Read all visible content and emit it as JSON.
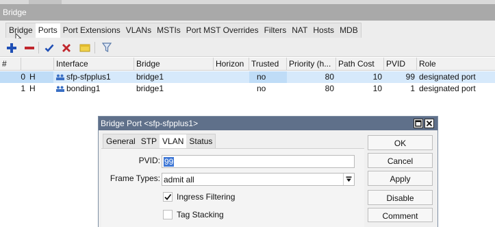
{
  "window": {
    "title": "Bridge"
  },
  "tabs": [
    "Bridge",
    "Ports",
    "Port Extensions",
    "VLANs",
    "MSTIs",
    "Port MST Overrides",
    "Filters",
    "NAT",
    "Hosts",
    "MDB"
  ],
  "active_tab": "Ports",
  "toolbar": {
    "buttons": [
      "add-icon",
      "remove-icon",
      "enable-icon",
      "disable-icon",
      "comment-icon",
      "filter-icon"
    ],
    "colors": {
      "add": "#1f4fb5",
      "remove": "#c0262c",
      "enable": "#1f4fb5",
      "disable": "#c0262c",
      "comment": "#e9c531",
      "filter": "#5a7aa8"
    }
  },
  "table": {
    "headers": {
      "num": "#",
      "interface": "Interface",
      "bridge": "Bridge",
      "horizon": "Horizon",
      "trusted": "Trusted",
      "priority": "Priority (h...",
      "path_cost": "Path Cost",
      "pvid": "PVID",
      "role": "Role"
    },
    "rows": [
      {
        "num": "0",
        "flag": "H",
        "interface": "sfp-sfpplus1",
        "bridge": "bridge1",
        "horizon": "",
        "trusted": "no",
        "priority": "80",
        "path_cost": "10",
        "pvid": "99",
        "role": "designated port"
      },
      {
        "num": "1",
        "flag": "H",
        "interface": "bonding1",
        "bridge": "bridge1",
        "horizon": "",
        "trusted": "no",
        "priority": "80",
        "path_cost": "10",
        "pvid": "1",
        "role": "designated port"
      }
    ]
  },
  "dialog": {
    "title": "Bridge Port <sfp-sfpplus1>",
    "tabs": [
      "General",
      "STP",
      "VLAN",
      "Status"
    ],
    "active_tab": "VLAN",
    "fields": {
      "pvid_label": "PVID:",
      "pvid_value": "99",
      "frame_types_label": "Frame Types:",
      "frame_types_value": "admit all"
    },
    "checkboxes": [
      {
        "label": "Ingress Filtering",
        "checked": true
      },
      {
        "label": "Tag Stacking",
        "checked": false
      }
    ],
    "buttons": [
      "OK",
      "Cancel",
      "Apply",
      "Disable",
      "Comment"
    ]
  }
}
